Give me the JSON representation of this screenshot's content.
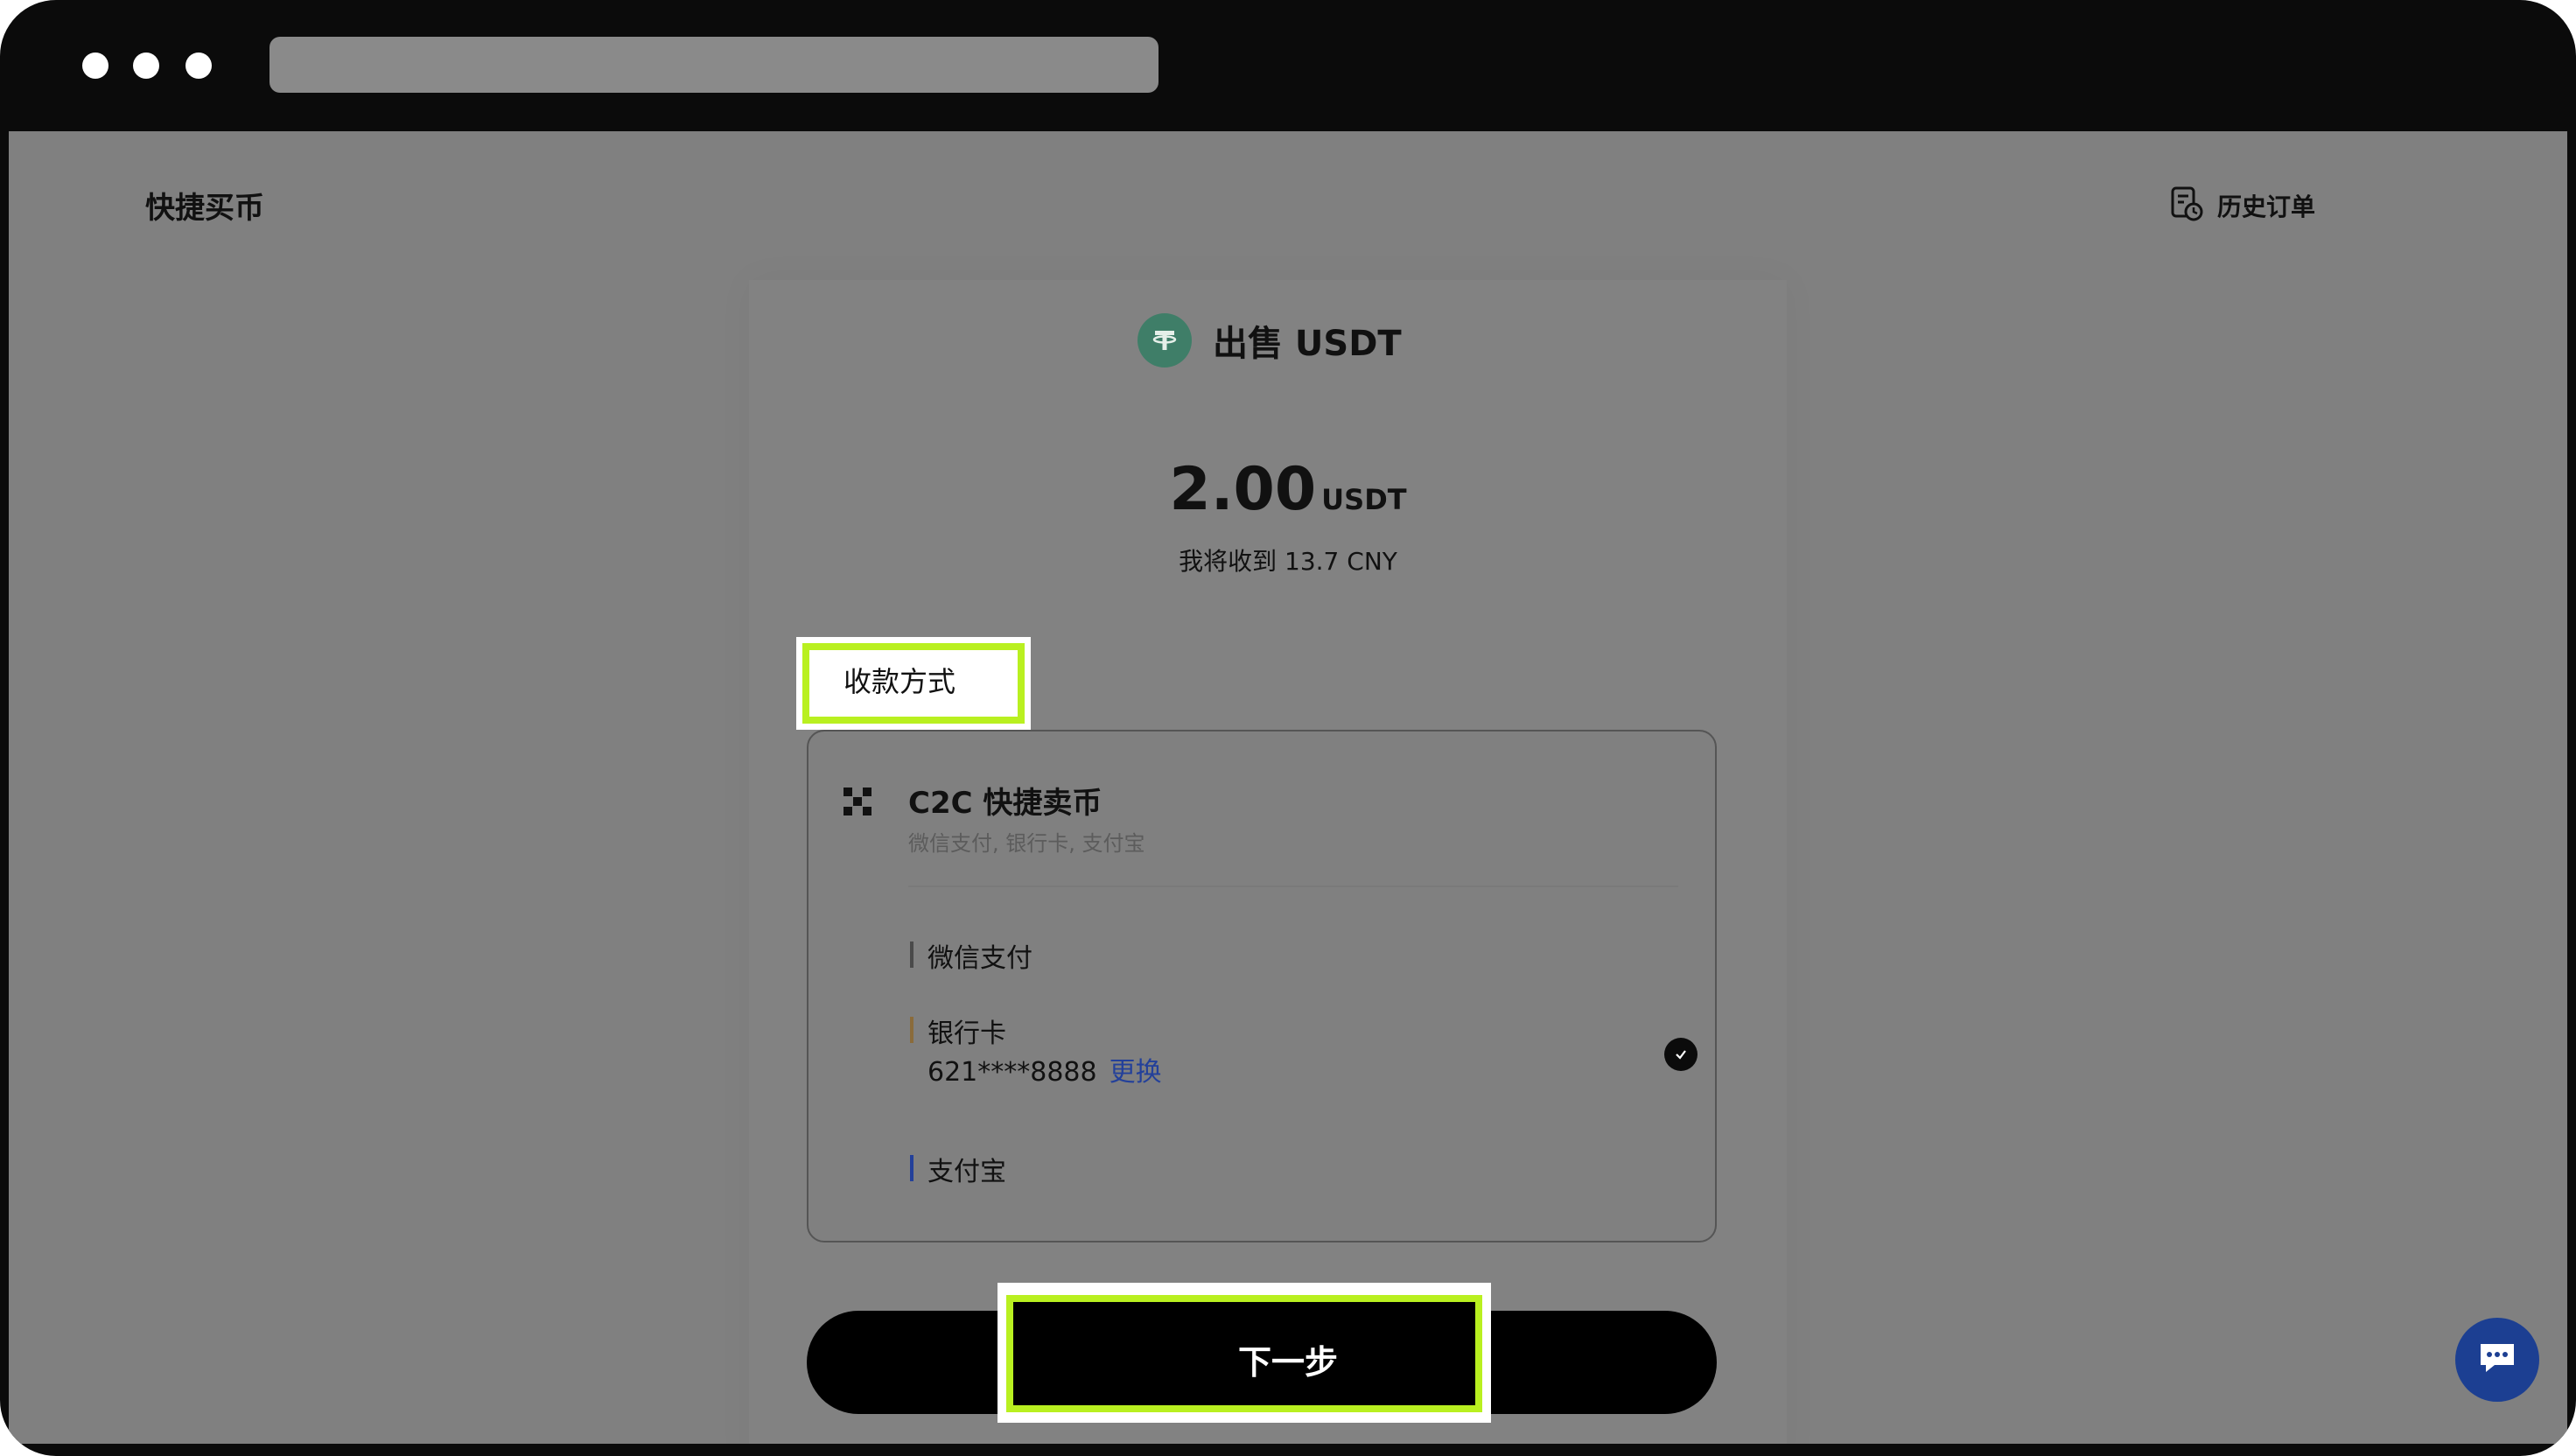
{
  "header": {
    "brand": "快捷买币",
    "history_label": "历史订单"
  },
  "token": {
    "title": "出售 USDT",
    "amount": "2.00",
    "unit": "USDT",
    "receive_text": "我将收到 13.7 CNY"
  },
  "payment": {
    "section_label": "收款方式",
    "c2c_title": "C2C 快捷卖币",
    "c2c_subtitle": "微信支付, 银行卡, 支付宝",
    "options": [
      {
        "label": "微信支付",
        "bar_color": "#4a4a4a"
      },
      {
        "label": "银行卡",
        "detail": "621****8888",
        "action": "更换",
        "bar_color": "#8a6b3a",
        "selected": true
      },
      {
        "label": "支付宝",
        "bar_color": "#23409a"
      }
    ]
  },
  "actions": {
    "next_label": "下一步"
  },
  "colors": {
    "highlight": "#b9f020",
    "link": "#23409a",
    "token_green": "#3f7e68",
    "chat_fab": "#1c3f92"
  }
}
